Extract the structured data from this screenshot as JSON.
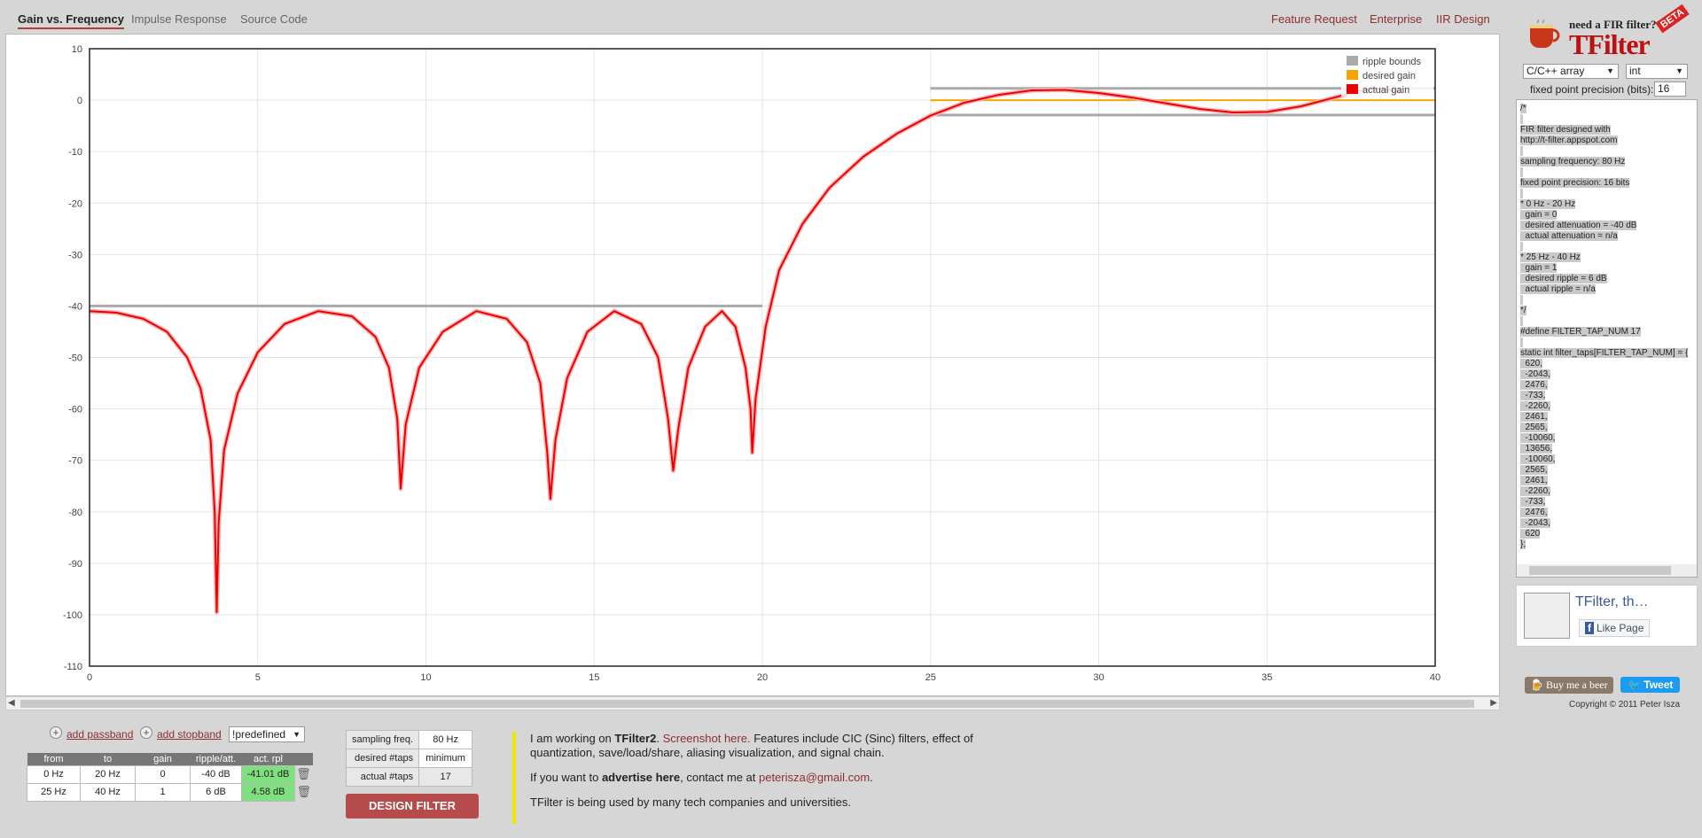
{
  "tabs": [
    "Gain vs. Frequency",
    "Impulse Response",
    "Source Code"
  ],
  "active_tab": 0,
  "top_links": [
    "Feature Request",
    "Enterprise",
    "IIR Design"
  ],
  "chart_data": {
    "type": "line",
    "xlim": [
      0,
      40
    ],
    "ylim": [
      -110,
      10
    ],
    "x_ticks": [
      0,
      5,
      10,
      15,
      20,
      25,
      30,
      35,
      40
    ],
    "y_ticks": [
      10,
      0,
      -10,
      -20,
      -30,
      -40,
      -50,
      -60,
      -70,
      -80,
      -90,
      -100,
      -110
    ],
    "grid": true,
    "legend_position": "top-right",
    "legend": [
      {
        "label": "ripple bounds",
        "color": "#aaaaaa"
      },
      {
        "label": "desired gain",
        "color": "#f5a500"
      },
      {
        "label": "actual gain",
        "color": "#ee0000"
      }
    ],
    "ripple_bounds": [
      {
        "x": [
          0,
          20
        ],
        "y": -40
      },
      {
        "x": [
          25,
          40
        ],
        "y": 2.3
      },
      {
        "x": [
          25,
          40
        ],
        "y": -2.9
      }
    ],
    "desired_gain": {
      "x": [
        25,
        40
      ],
      "y": 0
    },
    "actual_gain_points": [
      [
        0,
        -41
      ],
      [
        0.8,
        -41.3
      ],
      [
        1.6,
        -42.5
      ],
      [
        2.3,
        -45
      ],
      [
        2.9,
        -50
      ],
      [
        3.3,
        -56
      ],
      [
        3.6,
        -66
      ],
      [
        3.72,
        -80
      ],
      [
        3.78,
        -99.5
      ],
      [
        3.84,
        -82
      ],
      [
        4.0,
        -68
      ],
      [
        4.4,
        -57
      ],
      [
        5.0,
        -49
      ],
      [
        5.8,
        -43.5
      ],
      [
        6.8,
        -41
      ],
      [
        7.8,
        -42
      ],
      [
        8.5,
        -46
      ],
      [
        8.9,
        -52
      ],
      [
        9.15,
        -62
      ],
      [
        9.25,
        -75.5
      ],
      [
        9.4,
        -63
      ],
      [
        9.8,
        -52
      ],
      [
        10.5,
        -45
      ],
      [
        11.5,
        -41
      ],
      [
        12.4,
        -42.5
      ],
      [
        13.0,
        -47
      ],
      [
        13.4,
        -55
      ],
      [
        13.6,
        -68
      ],
      [
        13.7,
        -77.5
      ],
      [
        13.85,
        -66
      ],
      [
        14.2,
        -54
      ],
      [
        14.8,
        -45
      ],
      [
        15.6,
        -41
      ],
      [
        16.4,
        -43.5
      ],
      [
        16.9,
        -50
      ],
      [
        17.2,
        -62
      ],
      [
        17.35,
        -72
      ],
      [
        17.5,
        -64
      ],
      [
        17.8,
        -52
      ],
      [
        18.3,
        -44
      ],
      [
        18.8,
        -41
      ],
      [
        19.2,
        -44
      ],
      [
        19.5,
        -52
      ],
      [
        19.65,
        -60
      ],
      [
        19.7,
        -68.5
      ],
      [
        19.8,
        -58
      ],
      [
        20.1,
        -44
      ],
      [
        20.5,
        -33
      ],
      [
        21.2,
        -24
      ],
      [
        22,
        -17
      ],
      [
        23,
        -11
      ],
      [
        24,
        -6.5
      ],
      [
        25,
        -3
      ],
      [
        26,
        -0.5
      ],
      [
        27,
        1
      ],
      [
        28,
        1.9
      ],
      [
        29,
        2
      ],
      [
        30,
        1.4
      ],
      [
        31,
        0.5
      ],
      [
        32,
        -0.6
      ],
      [
        33,
        -1.7
      ],
      [
        34,
        -2.4
      ],
      [
        35,
        -2.3
      ],
      [
        36,
        -1.2
      ],
      [
        37,
        0.5
      ],
      [
        37.8,
        1.9
      ],
      [
        38.2,
        2.3
      ],
      [
        38.6,
        2.0
      ],
      [
        39,
        1.6
      ]
    ]
  },
  "right": {
    "logo_tag": "need a FIR filter?",
    "logo_title": "TFilter",
    "logo_beta": "BETA",
    "output_format": "C/C++ array",
    "number_type": "int",
    "fpp_label": "fixed point precision (bits):",
    "fpp_value": "16",
    "code_lines": [
      "/*",
      "",
      "FIR filter designed with",
      "http://t-filter.appspot.com",
      "",
      "sampling frequency: 80 Hz",
      "",
      "fixed point precision: 16 bits",
      "",
      "* 0 Hz - 20 Hz",
      "  gain = 0",
      "  desired attenuation = -40 dB",
      "  actual attenuation = n/a",
      "",
      "* 25 Hz - 40 Hz",
      "  gain = 1",
      "  desired ripple = 6 dB",
      "  actual ripple = n/a",
      "",
      "*/",
      "",
      "#define FILTER_TAP_NUM 17",
      "",
      "static int filter_taps[FILTER_TAP_NUM] = {",
      "  620,",
      "  -2043,",
      "  2476,",
      "  -733,",
      "  -2260,",
      "  2461,",
      "  2565,",
      "  -10060,",
      "  13656,",
      "  -10060,",
      "  2565,",
      "  2461,",
      "  -2260,",
      "  -733,",
      "  2476,",
      "  -2043,",
      "  620",
      "};"
    ],
    "fb_title": "TFilter, th…",
    "fb_like": "Like Page",
    "beer": "Buy me a beer",
    "tweet": "Tweet",
    "copyright": "Copyright © 2011 Peter Isza"
  },
  "bands": {
    "add_passband": "add passband",
    "add_stopband": "add stopband",
    "predefined": "!predefined",
    "headers": [
      "from",
      "to",
      "gain",
      "ripple/att.",
      "act. rpl"
    ],
    "rows": [
      [
        "0 Hz",
        "20 Hz",
        "0",
        "-40 dB",
        "-41.01 dB"
      ],
      [
        "25 Hz",
        "40 Hz",
        "1",
        "6 dB",
        "4.58 dB"
      ]
    ]
  },
  "params": {
    "sampling_label": "sampling freq.",
    "sampling_value": "80 Hz",
    "taps_label": "desired #taps",
    "taps_value": "minimum",
    "actual_label": "actual #taps",
    "actual_value": "17",
    "design_button": "DESIGN FILTER"
  },
  "info": {
    "p1_a": "I am working on ",
    "p1_b": "TFilter2",
    "p1_c": ". ",
    "p1_link": "Screenshot here.",
    "p1_d": " Features include CIC (Sinc) filters, effect of quantization, save/load/share, aliasing visualization, and signal chain.",
    "p2_a": "If you want to ",
    "p2_b": "advertise here",
    "p2_c": ", contact me at ",
    "p2_email": "peterisza@gmail.com",
    "p2_d": ".",
    "p3": "TFilter is being used by many tech companies and universities."
  }
}
